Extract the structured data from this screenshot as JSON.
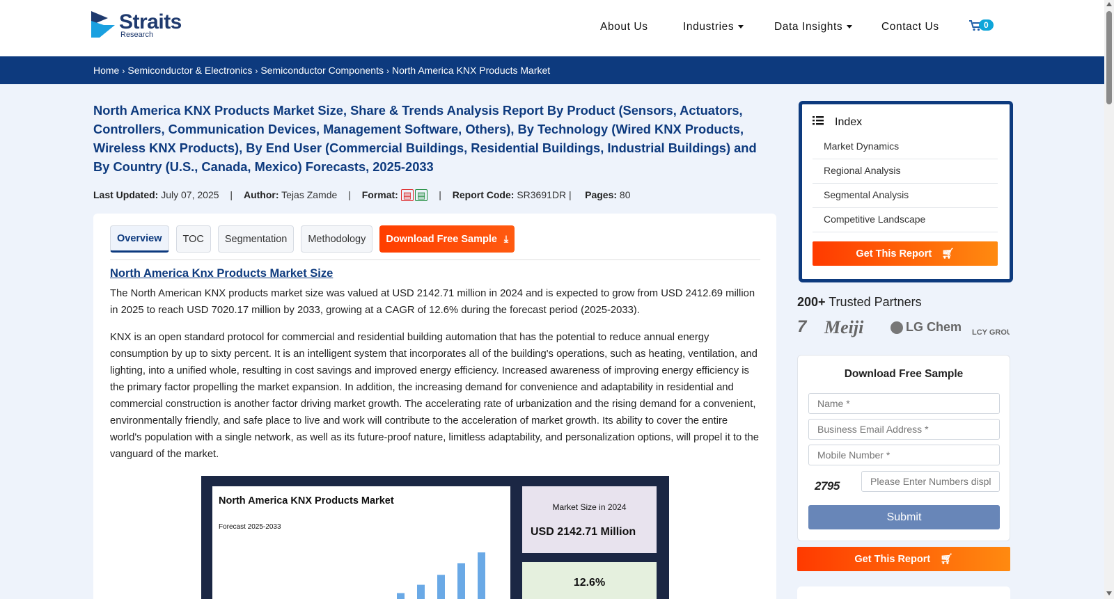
{
  "header": {
    "logo_main": "Straits",
    "logo_sub": "Research",
    "nav": [
      "About Us",
      "Industries",
      "Data Insights",
      "Contact Us"
    ],
    "cart_count": "0"
  },
  "breadcrumb": [
    "Home",
    "Semiconductor & Electronics",
    "Semiconductor Components",
    "North America KNX Products Market"
  ],
  "report": {
    "title": "North America KNX Products Market Size, Share & Trends Analysis Report By Product (Sensors, Actuators, Controllers, Communication Devices, Management Software, Others), By Technology (Wired KNX Products, Wireless KNX Products), By End User (Commercial Buildings, Residential Buildings, Industrial Buildings) and By Country (U.S., Canada, Mexico) Forecasts, 2025-2033",
    "last_updated_label": "Last Updated:",
    "last_updated": "July 07, 2025",
    "author_label": "Author:",
    "author": "Tejas Zamde",
    "format_label": "Format:",
    "report_code_label": "Report Code:",
    "report_code": "SR3691DR |",
    "pages_label": "Pages:",
    "pages": "80"
  },
  "tabs": [
    "Overview",
    "TOC",
    "Segmentation",
    "Methodology"
  ],
  "download_tab": "Download Free Sample",
  "content": {
    "heading": "North America Knx Products Market Size",
    "para1": "The North American KNX products market size was valued at USD 2142.71 million in 2024 and is expected to grow from USD 2412.69 million in 2025 to reach USD 7020.17 million by 2033, growing at a CAGR of 12.6% during the forecast period (2025-2033).",
    "para2": "KNX is an open standard protocol for commercial and residential building automation that has the potential to reduce annual energy consumption by up to sixty percent. It is an intelligent system that incorporates all of the building's operations, such as heating, ventilation, and lighting, into a unified whole, resulting in cost savings and improved energy efficiency. Increased awareness of improving energy efficiency is the primary factor propelling the market expansion. In addition, the increasing demand for convenience and adaptability in residential and commercial construction is another factor driving market growth. The accelerating rate of urbanization and the rising demand for a convenient, environmentally friendly, and safe place to live and work will contribute to the acceleration of market growth. Its ability to cover the entire world's population with a single network, as well as its future-proof nature, limitless adaptability, and personalization options, will propel it to the vanguard of the market."
  },
  "infographic": {
    "title": "North America KNX Products Market",
    "subtitle": "Forecast 2025-2033",
    "size_label": "Market Size in 2024",
    "size_value": "USD 2142.71 Million",
    "cagr_value": "12.6%"
  },
  "chart_data": {
    "type": "bar",
    "title": "North America KNX Products Market",
    "subtitle": "Forecast 2025-2033",
    "values": [
      9,
      18,
      28,
      40,
      54,
      67
    ],
    "note": "bars only partially visible; relative heights"
  },
  "sidebar": {
    "index_title": "Index",
    "index_items": [
      "Market Dynamics",
      "Regional Analysis",
      "Segmental Analysis",
      "Competitive Landscape"
    ],
    "get_report": "Get This Report",
    "partners_count": "200+",
    "partners_text": "Trusted Partners",
    "partners": [
      "7",
      "Meiji",
      "LG Chem",
      "LCY GROU"
    ],
    "form_title": "Download Free Sample",
    "name_placeholder": "Name *",
    "email_placeholder": "Business Email Address *",
    "mobile_placeholder": "Mobile Number *",
    "captcha_text": "2795",
    "captcha_placeholder": "Please Enter Numbers displ",
    "submit": "Submit"
  }
}
